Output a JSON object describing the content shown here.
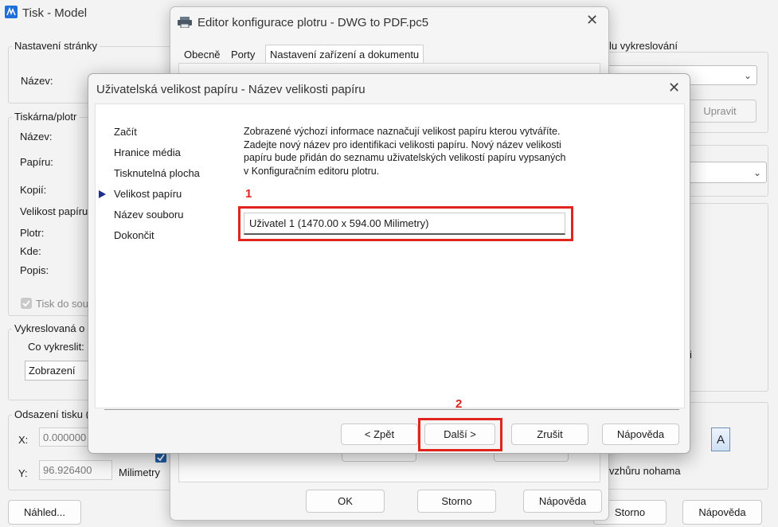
{
  "main": {
    "title": "Tisk - Model",
    "page_setup": {
      "group_label": "Nastavení stránky",
      "name_label": "Název:"
    },
    "printer": {
      "group_label": "Tiskárna/plotr",
      "name_label": "Název:",
      "paper_label": "Papíru:",
      "copies_label": "Kopií:",
      "paper_size_label": "Velikost papíru",
      "plotter_label": "Plotr:",
      "where_label": "Kde:",
      "description_label": "Popis:",
      "print_to_file_label": "Tisk do sou"
    },
    "plot_area": {
      "group_label": "Vykreslovaná o",
      "what_label": "Co vykreslit:",
      "what_value": "Zobrazení"
    },
    "plot_offset": {
      "group_label": "Odsazení tisku (",
      "x_label": "X:",
      "x_value": "0.000000",
      "y_label": "Y:",
      "y_value": "96.926400",
      "units": "Milimetry"
    },
    "right": {
      "style_label": "lu vykreslování",
      "edit_button": "Upravit",
      "upside_down": "vzhůru nohama",
      "orientation_icon": "A",
      "stray_char": "i"
    },
    "preview_button": "Náhled...",
    "storno_button": "Storno",
    "help_button": "Nápověda"
  },
  "editor": {
    "title": "Editor konfigurace plotru - DWG to PDF.pc5",
    "tabs": [
      "Obecně",
      "Porty",
      "Nastavení zařízení a dokumentu"
    ],
    "ok_button": "OK",
    "storno_button": "Storno",
    "help_button": "Nápověda"
  },
  "wizard": {
    "title": "Uživatelská velikost papíru - Název velikosti papíru",
    "steps": [
      "Začít",
      "Hranice média",
      "Tisknutelná plocha",
      "Velikost papíru",
      "Název souboru",
      "Dokončit"
    ],
    "active_step": 3,
    "description": "Zobrazené výchozí informace naznačují velikost papíru kterou vytváříte. Zadejte nový název pro identifikaci velikosti papíru. Nový název velikosti papíru bude přidán do seznamu uživatelských velikostí papíru vypsaných v Konfiguračním editoru plotru.",
    "paper_name_value": "Uživatel 1 (1470.00 x 594.00 Milimetry)",
    "back_button": "< Zpět",
    "next_button": "Další >",
    "cancel_button": "Zrušit",
    "help_button": "Nápověda"
  },
  "annotations": {
    "marker_1": "1",
    "marker_2": "2"
  },
  "colors": {
    "annotation_red": "#e2241f",
    "step_arrow": "#1f2f8f",
    "checkbox_blue": "#1f5fa8"
  }
}
